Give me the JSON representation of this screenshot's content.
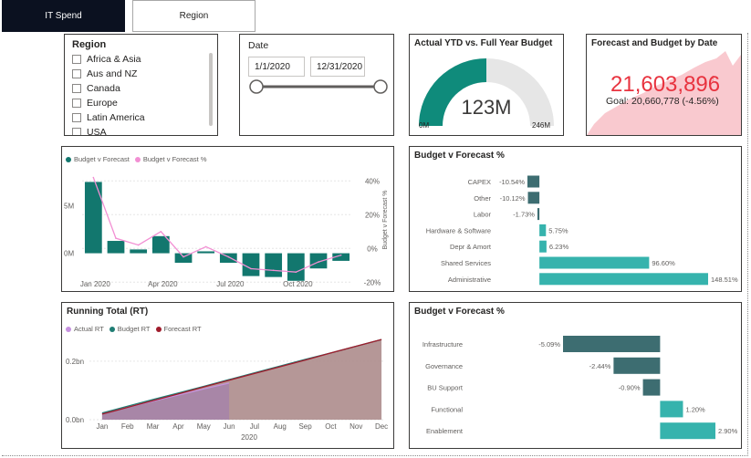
{
  "tabs": [
    {
      "label": "IT Spend",
      "active": true
    },
    {
      "label": "Region",
      "active": false
    }
  ],
  "region_slicer": {
    "title": "Region",
    "items": [
      "Africa & Asia",
      "Aus and NZ",
      "Canada",
      "Europe",
      "Latin America",
      "USA"
    ]
  },
  "date_slicer": {
    "title": "Date",
    "start": "1/1/2020",
    "end": "12/31/2020"
  },
  "gauge": {
    "title": "Actual YTD vs. Full Year Budget",
    "value_label": "123M",
    "min_label": "0M",
    "max_label": "246M",
    "value": 123,
    "max": 246,
    "colors": {
      "fill": "#0f8b7b",
      "track": "#e6e6e6"
    }
  },
  "kpi": {
    "title": "Forecast and Budget by Date",
    "value": "21,603,896",
    "indicator": "!",
    "goal": "Goal: 20,660,778 (-4.56%)",
    "colors": {
      "value": "#e8333f",
      "area": "#f9c9cf"
    }
  },
  "combo_chart": {
    "legend": [
      "Budget v Forecast",
      "Budget v Forecast %"
    ]
  },
  "bar_chart_1": {
    "title": "Budget v Forecast %"
  },
  "running_total": {
    "title": "Running Total (RT)",
    "legend": [
      "Actual RT",
      "Budget RT",
      "Forecast RT"
    ]
  },
  "bar_chart_2": {
    "title": "Budget v Forecast %"
  },
  "colors": {
    "teal_dark": "#12776e",
    "teal_light": "#36b3ad",
    "pink": "#f28fd3",
    "slate": "#3d6d71",
    "budget_rt": "#1f7d74",
    "forecast_rt": "#a01c2c",
    "actual_rt": "#c691e0"
  },
  "chart_data": [
    {
      "type": "bar",
      "name": "combo",
      "categories": [
        "Jan",
        "Feb",
        "Mar",
        "Apr",
        "May",
        "Jun",
        "Jul",
        "Aug",
        "Sep",
        "Oct",
        "Nov",
        "Dec"
      ],
      "x_tick_labels": [
        "Jan 2020",
        "Apr 2020",
        "Jul 2020",
        "Oct 2020"
      ],
      "series": [
        {
          "name": "Budget v Forecast",
          "values": [
            7.5,
            1.3,
            0.4,
            1.8,
            -1.0,
            0.2,
            -1.0,
            -2.4,
            -2.5,
            -2.9,
            -1.6,
            -0.8
          ]
        },
        {
          "name": "Budget v Forecast %",
          "values": [
            42,
            6,
            2,
            10,
            -5,
            1,
            -5,
            -12,
            -13,
            -14,
            -8,
            -4
          ]
        }
      ],
      "y_tick_labels": [
        "5M",
        "0M"
      ],
      "y2_tick_labels": [
        "40%",
        "20%",
        "0%",
        "-20%"
      ],
      "y2label": "Budget v Forecast %",
      "ylim": [
        -3.4,
        8.5
      ],
      "y2lim": [
        -22,
        45
      ]
    },
    {
      "type": "bar",
      "name": "budget_v_forecast_pct_1",
      "categories": [
        "CAPEX",
        "Other",
        "Labor",
        "Hardware & Software",
        "Depr & Amort",
        "Shared Services",
        "Administrative"
      ],
      "values": [
        -10.54,
        -10.12,
        -1.73,
        5.75,
        6.23,
        96.6,
        148.51
      ],
      "labels": [
        "-10.54%",
        "-10.12%",
        "-1.73%",
        "5.75%",
        "6.23%",
        "96.60%",
        "148.51%"
      ]
    },
    {
      "type": "area",
      "name": "running_total",
      "categories": [
        "Jan",
        "Feb",
        "Mar",
        "Apr",
        "May",
        "Jun",
        "Jul",
        "Aug",
        "Sep",
        "Oct",
        "Nov",
        "Dec"
      ],
      "xlabel": "2020",
      "y_tick_labels": [
        "0.2bn",
        "0.0bn"
      ],
      "ylim": [
        0,
        0.29
      ],
      "series": [
        {
          "name": "Actual RT",
          "values": [
            0.021,
            0.042,
            0.063,
            0.084,
            0.105,
            0.125,
            null,
            null,
            null,
            null,
            null,
            null
          ]
        },
        {
          "name": "Budget RT",
          "values": [
            0.023,
            0.046,
            0.069,
            0.091,
            0.114,
            0.137,
            0.16,
            0.183,
            0.206,
            0.228,
            0.251,
            0.274
          ]
        },
        {
          "name": "Forecast RT",
          "values": [
            0.019,
            0.042,
            0.065,
            0.088,
            0.112,
            0.135,
            0.158,
            0.181,
            0.204,
            0.228,
            0.251,
            0.274
          ]
        }
      ]
    },
    {
      "type": "bar",
      "name": "budget_v_forecast_pct_2",
      "categories": [
        "Infrastructure",
        "Governance",
        "BU Support",
        "Functional",
        "Enablement"
      ],
      "values": [
        -5.09,
        -2.44,
        -0.9,
        1.2,
        2.9
      ],
      "labels": [
        "-5.09%",
        "-2.44%",
        "-0.90%",
        "1.20%",
        "2.90%"
      ]
    }
  ]
}
